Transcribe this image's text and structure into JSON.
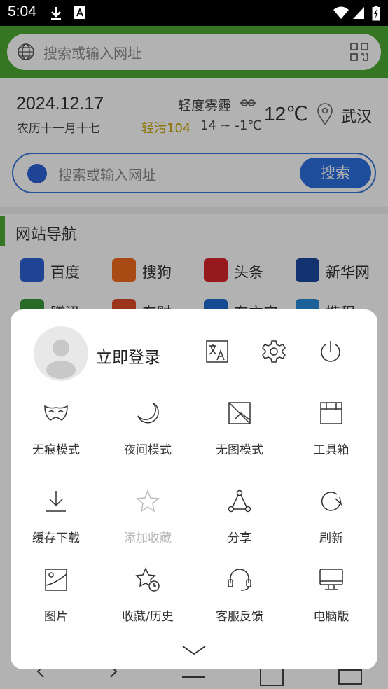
{
  "status_bar": {
    "time": "5:04"
  },
  "address_bar": {
    "placeholder": "搜索或输入网址"
  },
  "info": {
    "date": "2024.12.17",
    "lunar": "农历十一月十七",
    "weather": "轻度雾霾",
    "aqi": "轻污104",
    "temp_range": "14 ~ -1℃",
    "temp": "12℃",
    "city": "武汉"
  },
  "search": {
    "placeholder": "搜索或输入网址",
    "button": "搜索"
  },
  "nav": {
    "title": "网站导航",
    "sites": [
      {
        "name": "百度",
        "color": "#2e62d6"
      },
      {
        "name": "搜狗",
        "color": "#f06a1d"
      },
      {
        "name": "头条",
        "color": "#d7252b"
      },
      {
        "name": "新华网",
        "color": "#1a4aa0"
      },
      {
        "name": "腾讯",
        "color": "#3a9a3a"
      },
      {
        "name": "东财",
        "color": "#e04b2a"
      },
      {
        "name": "东方宝",
        "color": "#1f6ed0"
      },
      {
        "name": "携程",
        "color": "#2a8ad8"
      }
    ]
  },
  "menu": {
    "login": "立即登录",
    "top_icons": [
      "translate-icon",
      "settings-gear-icon",
      "power-icon"
    ],
    "modes": [
      "无痕模式",
      "夜间模式",
      "无图模式",
      "工具箱"
    ],
    "row2": [
      "缓存下载",
      "添加收藏",
      "分享",
      "刷新"
    ],
    "row3": [
      "图片",
      "收藏/历史",
      "客服反馈",
      "电脑版"
    ]
  }
}
